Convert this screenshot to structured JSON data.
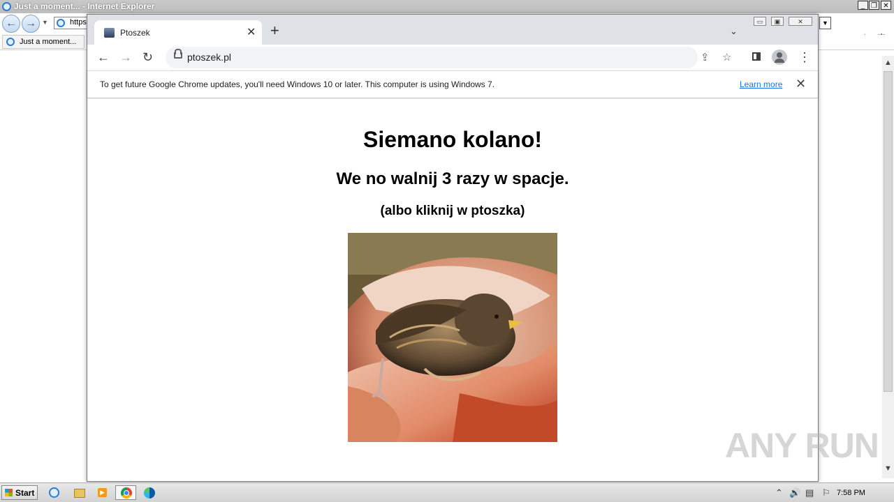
{
  "ie": {
    "window_title": "Just a moment... - Internet Explorer",
    "address_text": "https:",
    "tab_label": "Just a moment..."
  },
  "chrome": {
    "tab_title": "Ptoszek",
    "url": "ptoszek.pl",
    "infobar_text": "To get future Google Chrome updates, you'll need Windows 10 or later. This computer is using Windows 7.",
    "infobar_link": "Learn more"
  },
  "page": {
    "heading": "Siemano kolano!",
    "subheading": "We no walnij 3 razy w spacje.",
    "note": "(albo kliknij w ptoszka)",
    "image_subject": "baby bird in a hand"
  },
  "watermark": "ANY RUN",
  "taskbar": {
    "start_label": "Start",
    "clock": "7:58 PM"
  },
  "colors": {
    "chrome_tabstrip": "#dee1e6",
    "omnibox": "#f1f3f4",
    "link": "#1a73e8"
  }
}
